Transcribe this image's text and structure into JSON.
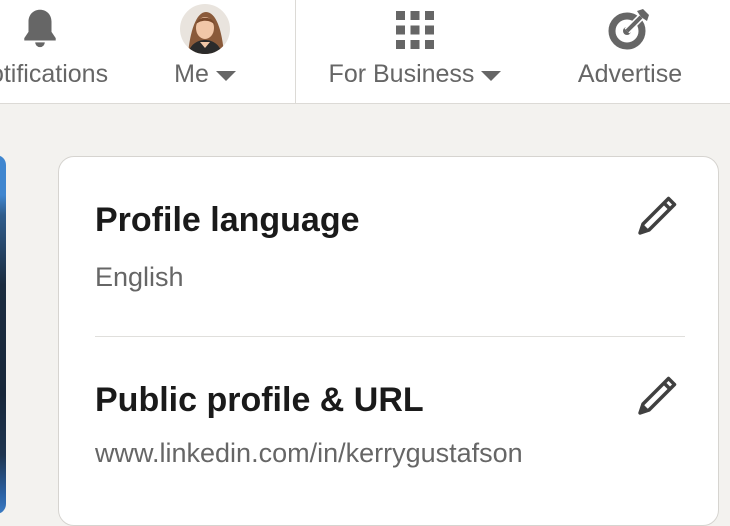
{
  "nav": {
    "notifications_label": "Notifications",
    "me_label": "Me",
    "business_label": "For Business",
    "advertise_label": "Advertise"
  },
  "profile_card": {
    "language": {
      "title": "Profile language",
      "value": "English"
    },
    "public_profile": {
      "title": "Public profile & URL",
      "value": "www.linkedin.com/in/kerrygustafson"
    }
  },
  "colors": {
    "nav_text": "#666666",
    "page_background": "#f3f2ef",
    "card_background": "#ffffff",
    "title_text": "#1a1a1a"
  },
  "icons": [
    "bell-icon",
    "avatar",
    "grid-icon",
    "target-arrow-icon",
    "pencil-icon"
  ]
}
